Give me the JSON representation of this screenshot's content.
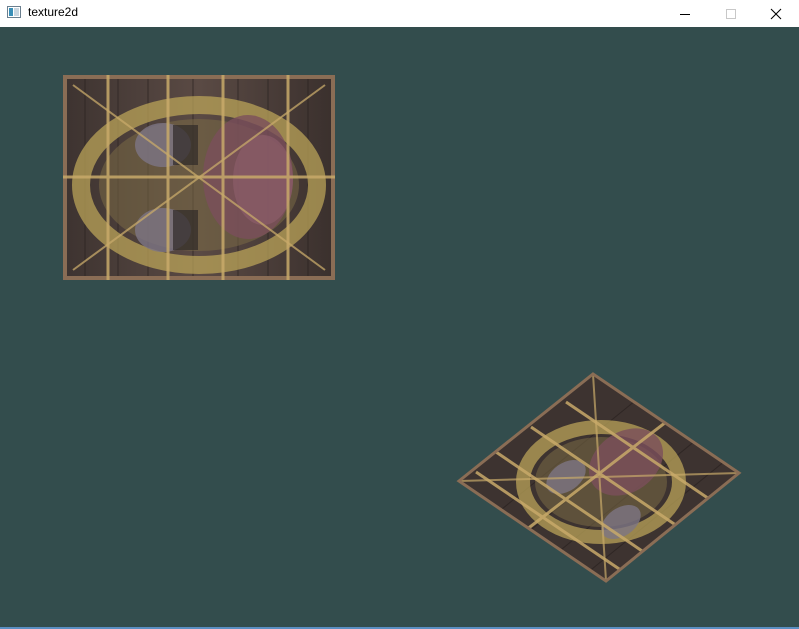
{
  "window": {
    "title": "texture2d"
  },
  "controls": {
    "minimize_icon": "minimize-icon",
    "maximize_icon": "maximize-icon",
    "close_icon": "close-icon"
  },
  "scene": {
    "clear_color": "#334d4d",
    "texture": "wooden-container-with-awesomeface",
    "quads": [
      {
        "name": "upright-textured-quad"
      },
      {
        "name": "rotated-textured-quad"
      }
    ]
  }
}
